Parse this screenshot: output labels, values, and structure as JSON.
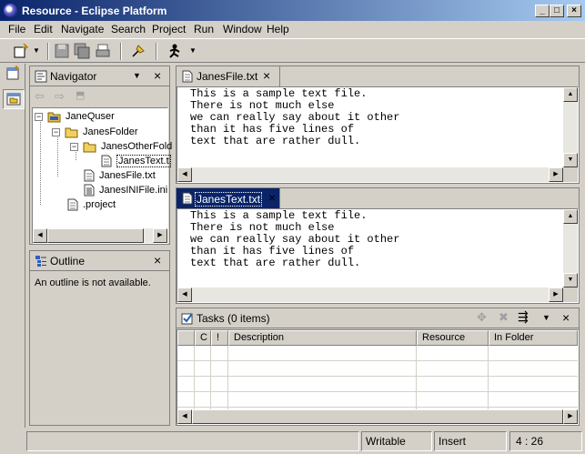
{
  "window": {
    "title": "Resource - Eclipse Platform"
  },
  "menu": [
    "File",
    "Edit",
    "Navigate",
    "Search",
    "Project",
    "Run",
    "Window",
    "Help"
  ],
  "navigator": {
    "title": "Navigator",
    "tree": [
      {
        "label": "JaneQuser",
        "type": "project"
      },
      {
        "label": "JanesFolder",
        "type": "folder"
      },
      {
        "label": "JanesOtherFold",
        "type": "folder"
      },
      {
        "label": "JanesText.t",
        "type": "file"
      },
      {
        "label": "JanesFile.txt",
        "type": "file"
      },
      {
        "label": "JanesINIFile.ini",
        "type": "file"
      },
      {
        "label": ".project",
        "type": "file"
      }
    ]
  },
  "outline": {
    "title": "Outline",
    "message": "An outline is not available."
  },
  "editors": [
    {
      "tab": "JanesFile.txt",
      "lines": [
        "This is a sample text file.",
        "There is not much else",
        "we can really say about it other",
        "than it has five lines of",
        "text that are rather dull."
      ]
    },
    {
      "tab": "JanesText.txt",
      "lines": [
        "This is a sample text file.",
        "There is not much else",
        "we can really say about it other",
        "than it has five lines of",
        "text that are rather dull."
      ]
    }
  ],
  "tasks": {
    "title": "Tasks (0 items)",
    "columns": [
      "C",
      "!",
      "Description",
      "Resource",
      "In Folder"
    ]
  },
  "status": {
    "mode": "Writable",
    "insert": "Insert",
    "position": "4 : 26"
  },
  "icons": {
    "minimize": "minimize-icon",
    "maximize": "maximize-icon",
    "close": "close-icon"
  }
}
